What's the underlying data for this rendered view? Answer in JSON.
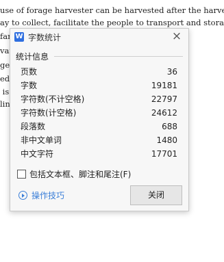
{
  "document": {
    "lines": [
      "use of forage harvester can be harvested after the harvest of crops di",
      "ay to collect, facilitate the people to transport and storage, reduc",
      "farn                                         ture  exper",
      "van                                          demand  fo",
      "ge                                          king  proce",
      "ed                                          On  the  ba",
      " is                                          is area.",
      "ling                                         ng process"
    ]
  },
  "dialog": {
    "title": "字数统计",
    "app_icon_letter": "W",
    "section_label": "统计信息",
    "stats": [
      {
        "label": "页数",
        "value": "36"
      },
      {
        "label": "字数",
        "value": "19181"
      },
      {
        "label": "字符数(不计空格)",
        "value": "22797"
      },
      {
        "label": "字符数(计空格)",
        "value": "24612"
      },
      {
        "label": "段落数",
        "value": "688"
      },
      {
        "label": "非中文单词",
        "value": "1480"
      },
      {
        "label": "中文字符",
        "value": "17701"
      }
    ],
    "checkbox_label": "包括文本框、脚注和尾注(F)",
    "checkbox_checked": false,
    "tips_label": "操作技巧",
    "close_button_label": "关闭"
  },
  "colors": {
    "accent": "#3b7fd8",
    "app_icon": "#2f6fe0",
    "dialog_background": "#f7f7f7"
  }
}
